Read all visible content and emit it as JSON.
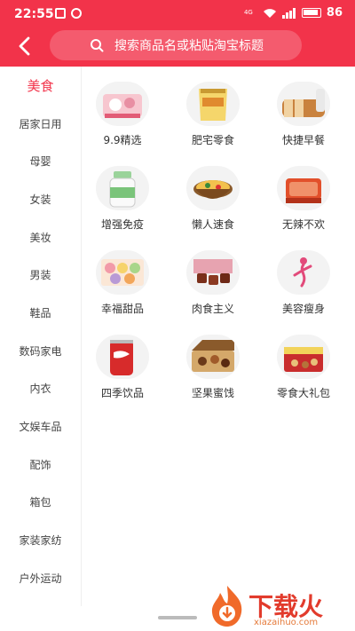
{
  "status_bar": {
    "time": "22:55",
    "network": "4G",
    "battery_level": "86"
  },
  "search": {
    "placeholder": "搜索商品名或粘贴淘宝标题"
  },
  "sidebar": {
    "items": [
      {
        "label": "美食",
        "active": true
      },
      {
        "label": "居家日用"
      },
      {
        "label": "母婴"
      },
      {
        "label": "女装"
      },
      {
        "label": "美妆"
      },
      {
        "label": "男装"
      },
      {
        "label": "鞋品"
      },
      {
        "label": "数码家电"
      },
      {
        "label": "内衣"
      },
      {
        "label": "文娱车品"
      },
      {
        "label": "配饰"
      },
      {
        "label": "箱包"
      },
      {
        "label": "家装家纺"
      },
      {
        "label": "户外运动"
      }
    ]
  },
  "categories": [
    {
      "label": "9.9精选",
      "icon": "pastry-box-icon"
    },
    {
      "label": "肥宅零食",
      "icon": "snack-bag-icon"
    },
    {
      "label": "快捷早餐",
      "icon": "bread-loaf-icon"
    },
    {
      "label": "增强免疫",
      "icon": "supplement-bottle-icon"
    },
    {
      "label": "懒人速食",
      "icon": "noodle-bowl-icon"
    },
    {
      "label": "无辣不欢",
      "icon": "spicy-meat-icon"
    },
    {
      "label": "幸福甜品",
      "icon": "macaron-icon"
    },
    {
      "label": "肉食主义",
      "icon": "meat-cubes-icon"
    },
    {
      "label": "美容瘦身",
      "icon": "slim-figure-icon"
    },
    {
      "label": "四季饮品",
      "icon": "soda-can-icon"
    },
    {
      "label": "坚果蜜饯",
      "icon": "nut-box-icon"
    },
    {
      "label": "零食大礼包",
      "icon": "gift-box-icon"
    }
  ],
  "watermark": {
    "text": "下载火",
    "subtext": "xiazaihuo.com"
  },
  "colors": {
    "accent": "#f2334a",
    "background": "#ffffff"
  }
}
